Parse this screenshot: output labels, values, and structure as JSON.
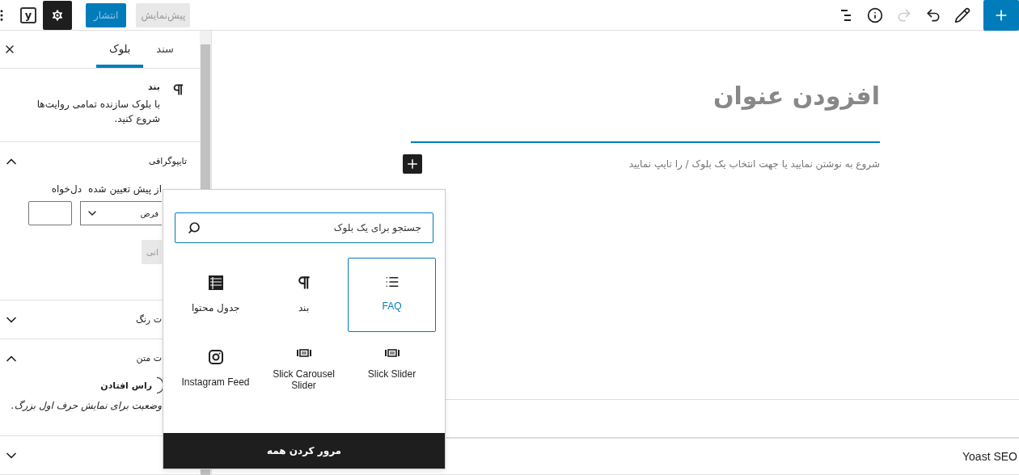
{
  "top_bar": {
    "logo": "y",
    "preview": "پیش‌نمایش",
    "publish": "انتشار",
    "tools": [
      {
        "kind": "outline",
        "disabled": false
      },
      {
        "kind": "info",
        "disabled": false
      },
      {
        "kind": "redo",
        "disabled": true
      },
      {
        "kind": "undo",
        "disabled": false
      },
      {
        "kind": "edit",
        "disabled": false
      },
      {
        "kind": "add",
        "disabled": false
      }
    ]
  },
  "sidebar": {
    "tabs": [
      {
        "label": "سند",
        "selected": false
      },
      {
        "label": "بلوک",
        "selected": true
      }
    ],
    "block": {
      "title": "بند",
      "description": "با بلوک سازنده تمامی روایت‌ها شروع کنید."
    },
    "panels": [
      {
        "kind": "typography",
        "title": "تایپوگرافی",
        "expanded": true,
        "size_label": "از پیش تعیین شده",
        "custom_label": "دل‌خواه",
        "select_value": "فرض",
        "reset": "انی"
      },
      {
        "kind": "plain",
        "title": "ت رنگ",
        "expanded": false
      },
      {
        "kind": "toggle",
        "title": "ت متن",
        "expanded": true,
        "toggle_label": "راس افتادن",
        "on": false,
        "help": "وضعیت برای نمایش حرف اول بزرگ."
      },
      {
        "kind": "plain",
        "expanded": false
      }
    ]
  },
  "editor": {
    "title_placeholder": "افزودن عنوان",
    "paragraph_placeholder": "شروع به نوشتن نمایید یا جهت انتخاب یک بلوک / را تایپ نمایید"
  },
  "metabox": {
    "title": "Yoast SEO"
  },
  "inserter": {
    "search_placeholder": "جستجو برای یک بلوک",
    "blocks": [
      {
        "kind": "list",
        "label": "FAQ",
        "selected": true
      },
      {
        "kind": "paragraph",
        "label": "بند",
        "selected": false
      },
      {
        "kind": "table",
        "label": "جدول محتوا",
        "selected": false
      },
      {
        "kind": "slider",
        "label": "Slick Slider",
        "selected": false
      },
      {
        "kind": "slider",
        "label": "Slick Carousel Slider",
        "selected": false
      },
      {
        "kind": "instagram",
        "label": "Instagram Feed",
        "selected": false
      }
    ],
    "browse_all": "مرور کردن همه"
  }
}
